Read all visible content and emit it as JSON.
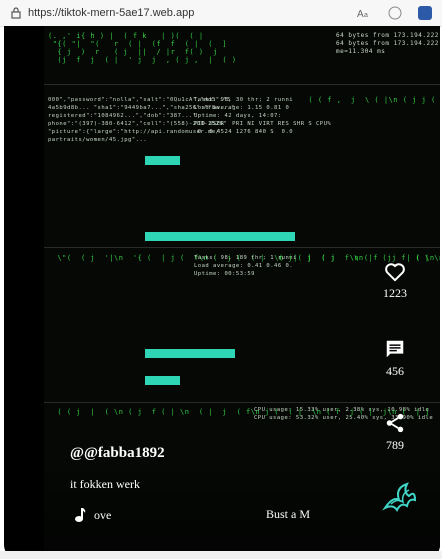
{
  "browser": {
    "url": "https://tiktok-mern-5ae17.web.app",
    "icons": [
      "lock-icon",
      "reader-mode-icon",
      "extension-icon"
    ]
  },
  "video": {
    "matrix_top_left": "(. ,' i{ h ) |  ( f k   | )(  ( |\n \"{( \"|  \"(   r  ( |  (f  f  ( |  (  ]\n  { j  )  r   ( j  ||  / |r  f( )  j \n  (j  f  j  ( |  ' j  j  , ( j ,  |  ( )",
    "matrix_top_right": "64 bytes from 173.194.222.2: icmp_seq=214 ttl=57 ti\n64 bytes from 173.194.222.2: icmp_seq=215 ttl=57 t\nme=11.304 ms",
    "json_block": "000\",\"password\":\"nolla\",\"salt\":\"0Qu1cA\",\"md5\":\"5\n4a5b9d8b... \"sha1\":\"9449ba7...\",\"sha256\":\"f8a...\"\nregistered\":\"1084962...\",\"dob\":\"387...\"\nphone\":\"(397)-380-6412\",\"cell\":\"(558)-200-2526\"\n\"picture\":{\"large\":\"http://api.randomuser.me/\npartraits/women/45.jpg\"...",
    "stats_text": "Tasks: 98, 30 thr; 2 runni\nLoad average: 1.15 0.81 0\nUptime: 42 days, 14:07:\nPID USER  PRI NI VIRT RES SHR S CPU%\n 0  0 4524 1276 840 S  0.0",
    "mid_stats": "Tasks: 98, 189 thr; 1 runni\nLoad average: 0.41 0.46 0.\nUptime: 00:53:59",
    "bottom_stats": "CPU usage: 15.33% user, 2.38% sys, 10.98% idle\nCPU usage: 53.32% user, 25.40% sys, 33.90% idle"
  },
  "actions": {
    "likes": "1223",
    "comments": "456",
    "shares": "789"
  },
  "post": {
    "username": "@@fabba1892",
    "caption": "it fokken werk",
    "music_label": "ove",
    "song": "Bust a M"
  }
}
